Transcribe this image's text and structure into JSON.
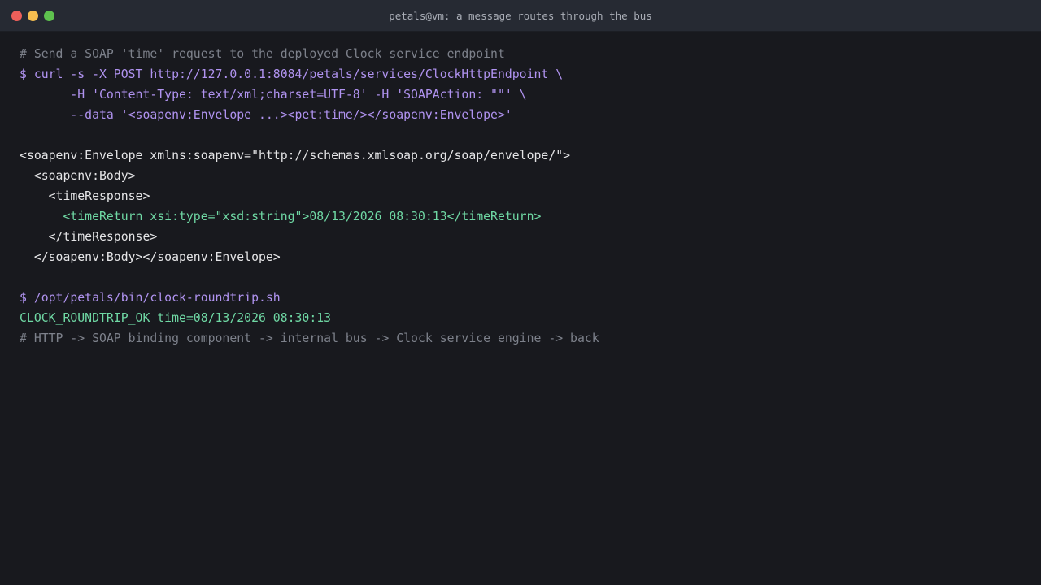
{
  "window": {
    "title": "petals@vm: a message routes through the bus"
  },
  "terminal": {
    "lines": [
      "# Send a SOAP 'time' request to the deployed Clock service endpoint",
      "$ curl -s -X POST http://127.0.0.1:8084/petals/services/ClockHttpEndpoint \\",
      "       -H 'Content-Type: text/xml;charset=UTF-8' -H 'SOAPAction: \"\"' \\",
      "       --data '<soapenv:Envelope ...><pet:time/></soapenv:Envelope>'",
      "",
      "<soapenv:Envelope xmlns:soapenv=\"http://schemas.xmlsoap.org/soap/envelope/\">",
      "  <soapenv:Body>",
      "    <timeResponse>",
      "      <timeReturn xsi:type=\"xsd:string\">08/13/2026 08:30:13</timeReturn>",
      "    </timeResponse>",
      "  </soapenv:Body></soapenv:Envelope>",
      "",
      "$ /opt/petals/bin/clock-roundtrip.sh",
      "CLOCK_ROUNDTRIP_OK time=08/13/2026 08:30:13",
      "# HTTP -> SOAP binding component -> internal bus -> Clock service engine -> back"
    ]
  },
  "colors": {
    "background": "#18191e",
    "titlebar": "#262a33",
    "comment": "#7d818b",
    "command": "#b093f0",
    "output": "#e4e4e6",
    "success": "#6fd8a4"
  }
}
